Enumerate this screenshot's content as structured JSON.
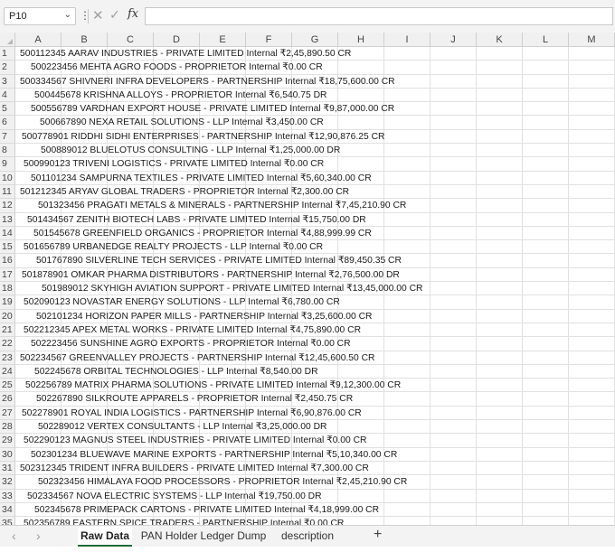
{
  "formula_bar": {
    "name_box": "P10",
    "cancel_icon": "close-icon",
    "enter_icon": "checkmark-icon",
    "function_label": "fx",
    "formula_value": ""
  },
  "columns": [
    "A",
    "B",
    "C",
    "D",
    "E",
    "F",
    "G",
    "H",
    "I",
    "J",
    "K",
    "L",
    "M"
  ],
  "rows": [
    {
      "n": "1",
      "text": "500112345 AARAV INDUSTRIES - PRIVATE LIMITED  Internal ₹2,45,890.50 CR"
    },
    {
      "n": "2",
      "text": "500223456 MEHTA AGRO FOODS - PROPRIETOR  Internal ₹0.00 CR"
    },
    {
      "n": "3",
      "text": "500334567 SHIVNERI INFRA DEVELOPERS - PARTNERSHIP  Internal ₹18,75,600.00 CR"
    },
    {
      "n": "4",
      "text": "500445678 KRISHNA ALLOYS - PROPRIETOR  Internal ₹6,540.75 DR"
    },
    {
      "n": "5",
      "text": "500556789 VARDHAN EXPORT HOUSE - PRIVATE LIMITED  Internal ₹9,87,000.00 CR"
    },
    {
      "n": "6",
      "text": "500667890 NEXA RETAIL SOLUTIONS - LLP  Internal ₹3,450.00 CR"
    },
    {
      "n": "7",
      "text": "500778901 RIDDHI SIDHI ENTERPRISES - PARTNERSHIP  Internal ₹12,90,876.25 CR"
    },
    {
      "n": "8",
      "text": "500889012 BLUELOTUS CONSULTING - LLP  Internal ₹1,25,000.00 DR"
    },
    {
      "n": "9",
      "text": "500990123 TRIVENI LOGISTICS - PRIVATE LIMITED  Internal ₹0.00 CR"
    },
    {
      "n": "10",
      "text": "501101234 SAMPURNA TEXTILES - PRIVATE LIMITED  Internal ₹5,60,340.00 CR"
    },
    {
      "n": "11",
      "text": "501212345 ARYAV GLOBAL TRADERS - PROPRIETOR  Internal ₹2,300.00 CR"
    },
    {
      "n": "12",
      "text": "501323456 PRAGATI METALS & MINERALS - PARTNERSHIP  Internal ₹7,45,210.90 CR"
    },
    {
      "n": "13",
      "text": "501434567 ZENITH BIOTECH LABS - PRIVATE LIMITED  Internal ₹15,750.00 DR"
    },
    {
      "n": "14",
      "text": "501545678 GREENFIELD ORGANICS - PROPRIETOR  Internal ₹4,88,999.99 CR"
    },
    {
      "n": "15",
      "text": "501656789 URBANEDGE REALTY PROJECTS - LLP  Internal ₹0.00 CR"
    },
    {
      "n": "16",
      "text": "501767890 SILVERLINE TECH SERVICES - PRIVATE LIMITED  Internal ₹89,450.35 CR"
    },
    {
      "n": "17",
      "text": "501878901 OMKAR PHARMA DISTRIBUTORS - PARTNERSHIP  Internal ₹2,76,500.00 DR"
    },
    {
      "n": "18",
      "text": "501989012 SKYHIGH AVIATION SUPPORT - PRIVATE LIMITED  Internal ₹13,45,000.00 CR"
    },
    {
      "n": "19",
      "text": "502090123 NOVASTAR ENERGY SOLUTIONS - LLP  Internal ₹6,780.00 CR"
    },
    {
      "n": "20",
      "text": "502101234 HORIZON PAPER MILLS - PARTNERSHIP  Internal ₹3,25,600.00 CR"
    },
    {
      "n": "21",
      "text": "502212345 APEX METAL WORKS - PRIVATE LIMITED  Internal ₹4,75,890.00 CR"
    },
    {
      "n": "22",
      "text": "502223456 SUNSHINE AGRO EXPORTS - PROPRIETOR  Internal ₹0.00 CR"
    },
    {
      "n": "23",
      "text": "502234567 GREENVALLEY PROJECTS - PARTNERSHIP  Internal ₹12,45,600.50 CR"
    },
    {
      "n": "24",
      "text": "502245678 ORBITAL TECHNOLOGIES - LLP  Internal ₹8,540.00 DR"
    },
    {
      "n": "25",
      "text": "502256789 MATRIX PHARMA SOLUTIONS - PRIVATE LIMITED  Internal ₹9,12,300.00 CR"
    },
    {
      "n": "26",
      "text": "502267890 SILKROUTE APPARELS - PROPRIETOR  Internal ₹2,450.75 CR"
    },
    {
      "n": "27",
      "text": "502278901 ROYAL INDIA LOGISTICS - PARTNERSHIP  Internal ₹6,90,876.00 CR"
    },
    {
      "n": "28",
      "text": "502289012 VERTEX CONSULTANTS - LLP  Internal ₹3,25,000.00 DR"
    },
    {
      "n": "29",
      "text": "502290123 MAGNUS STEEL INDUSTRIES - PRIVATE LIMITED  Internal ₹0.00 CR"
    },
    {
      "n": "30",
      "text": "502301234 BLUEWAVE MARINE EXPORTS - PARTNERSHIP  Internal ₹5,10,340.00 CR"
    },
    {
      "n": "31",
      "text": "502312345 TRIDENT INFRA BUILDERS - PRIVATE LIMITED  Internal ₹7,300.00 CR"
    },
    {
      "n": "32",
      "text": "502323456 HIMALAYA FOOD PROCESSORS - PROPRIETOR  Internal ₹2,45,210.90 CR"
    },
    {
      "n": "33",
      "text": "502334567 NOVA ELECTRIC SYSTEMS - LLP  Internal ₹19,750.00 DR"
    },
    {
      "n": "34",
      "text": "502345678 PRIMEPACK CARTONS - PRIVATE LIMITED  Internal ₹4,18,999.00 CR"
    },
    {
      "n": "35",
      "text": "502356789 EASTERN SPICE TRADERS - PARTNERSHIP  Internal ₹0.00 CR"
    }
  ],
  "sheet_tabs": [
    {
      "label": "Raw Data",
      "active": true
    },
    {
      "label": "PAN Holder Ledger Dump",
      "active": false
    },
    {
      "label": "description",
      "active": false
    }
  ],
  "nav_prev_icon": "chevron-left-icon",
  "nav_next_icon": "chevron-right-icon",
  "add_sheet_icon": "plus-icon",
  "colors": {
    "accent": "#1e6b3a",
    "header_bg": "#f0f0f0",
    "gridline": "#e1e1e1"
  }
}
